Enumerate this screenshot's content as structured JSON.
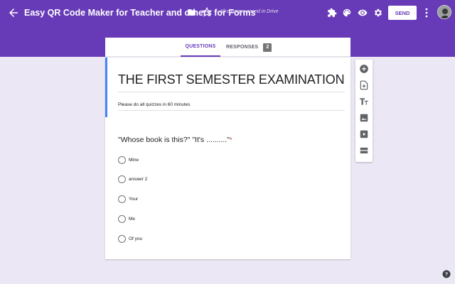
{
  "header": {
    "title": "Easy QR Code Maker for Teacher and others for Forms",
    "save_status": "All changes saved in Drive",
    "send_label": "SEND",
    "icons": [
      "arrow-back-icon",
      "folder-icon",
      "star-icon",
      "puzzle-icon",
      "palette-icon",
      "eye-icon",
      "gear-icon",
      "more-vert-icon"
    ],
    "accent_color": "#673ab7"
  },
  "tabs": {
    "questions": "QUESTIONS",
    "responses": "RESPONSES",
    "responses_count": "2"
  },
  "form": {
    "title": "THE FIRST SEMESTER EXAMINATION",
    "description": "Please do all quizzes in 60 minutes",
    "question": "\"Whose book is this?\" \"It's ..........\"",
    "required_mark": "*",
    "options": [
      {
        "label": "Mine"
      },
      {
        "label": "answer 2"
      },
      {
        "label": "Your"
      },
      {
        "label": "Me"
      },
      {
        "label": "Of you"
      }
    ]
  },
  "tools": [
    "add-question-icon",
    "import-questions-icon",
    "add-title-icon",
    "add-image-icon",
    "add-video-icon",
    "add-section-icon"
  ]
}
